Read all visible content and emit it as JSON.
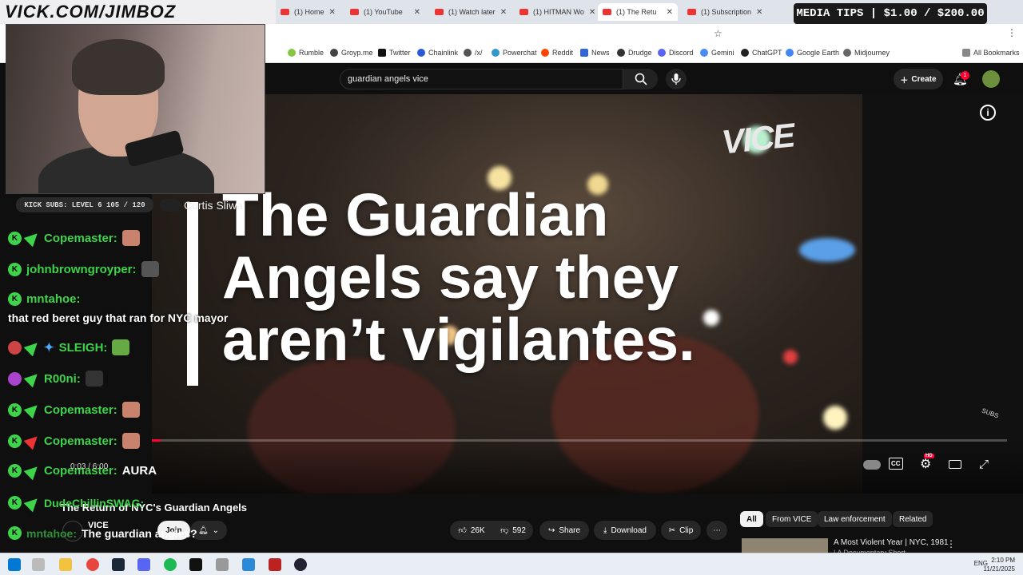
{
  "overlay": {
    "channel_url": "VICK.COM/JIMBOZ",
    "media_tips": "MEDIA TIPS | $1.00 / $200.00",
    "kick_subs": "KICK SUBS: LEVEL 6 105 / 120",
    "overlay_name": "Curtis Sliwa"
  },
  "browser": {
    "tabs": [
      {
        "label": "(1) Home"
      },
      {
        "label": "(1) YouTube"
      },
      {
        "label": "(1) Watch later"
      },
      {
        "label": "(1) HITMAN Wo"
      },
      {
        "label": "(1) The Retu"
      },
      {
        "label": "(1) Subscription"
      }
    ],
    "bookmarks": [
      "Rumble",
      "Groyp.me",
      "Twitter",
      "Chainlink",
      "/x/",
      "Powerchat",
      "Reddit",
      "News",
      "Drudge",
      "Discord",
      "Gemini",
      "ChatGPT",
      "Google Earth",
      "Midjourney"
    ],
    "all_bookmarks": "All Bookmarks"
  },
  "youtube": {
    "search_value": "guardian angels vice",
    "create_label": "Create",
    "notification_count": "1",
    "video_overlay_text": [
      "The Guardian",
      "Angels say they",
      "aren’t vigilantes."
    ],
    "vice_logo": "VICE",
    "time": "0:03 / 6:00",
    "title": "The Return of NYC's Guardian Angels",
    "channel": "VICE",
    "join_label": "Join",
    "likes": "26K",
    "dislikes": "592",
    "share_label": "Share",
    "download_label": "Download",
    "clip_label": "Clip",
    "chips": [
      "All",
      "From VICE",
      "Law enforcement",
      "Related"
    ],
    "related_title": "A Most Violent Year | NYC, 1981",
    "related_sub": "| A Documentary Short",
    "hd_badge": "HD"
  },
  "chat": {
    "messages": [
      {
        "user": "Copemaster:",
        "text": ""
      },
      {
        "user": "johnbrowngroyper:",
        "text": ""
      },
      {
        "user": "mntahoe:",
        "text": "that red beret guy that ran for NYC mayor"
      },
      {
        "user": "SLEIGH:",
        "text": ""
      },
      {
        "user": "R00ni:",
        "text": ""
      },
      {
        "user": "Copemaster:",
        "text": ""
      },
      {
        "user": "Copemaster:",
        "text": ""
      },
      {
        "user": "Copemaster:",
        "text": "AURA"
      },
      {
        "user": "DudeChillinSWAG:",
        "text": ""
      },
      {
        "user": "mntahoe:",
        "text": "The guardian angles?"
      }
    ]
  },
  "taskbar": {
    "lang": "ENG",
    "time": "2:10 PM",
    "date": "11/21/2025"
  },
  "colors": {
    "kick_green": "#3dd44a",
    "yt_red": "#ff0033"
  }
}
